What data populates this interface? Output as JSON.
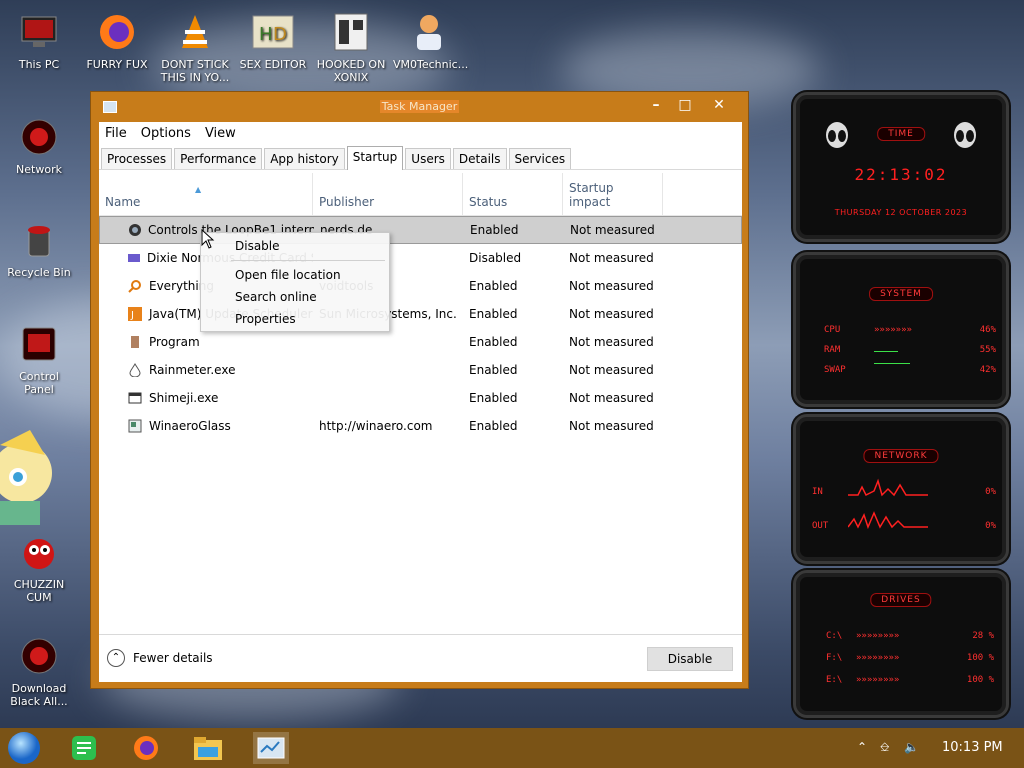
{
  "desktop": {
    "icons": [
      {
        "label": "This PC"
      },
      {
        "label": "FURRY FUX"
      },
      {
        "label": "DONT STICK THIS IN YO..."
      },
      {
        "label": "SEX EDITOR"
      },
      {
        "label": "HOOKED ON XONIX"
      },
      {
        "label": "VM0Technic..."
      },
      {
        "label": "Network"
      },
      {
        "label": "Recycle Bin"
      },
      {
        "label": "Control Panel"
      },
      {
        "label": "CHUZZIN CUM"
      },
      {
        "label": "Download Black All..."
      }
    ]
  },
  "task_manager": {
    "title": "Task Manager",
    "menu": [
      "File",
      "Options",
      "View"
    ],
    "tabs": [
      "Processes",
      "Performance",
      "App history",
      "Startup",
      "Users",
      "Details",
      "Services"
    ],
    "active_tab": "Startup",
    "columns": [
      "Name",
      "Publisher",
      "Status",
      "Startup impact"
    ],
    "rows": [
      {
        "name": "Controls the LoopBe1 intern...",
        "publisher": "nerds.de",
        "status": "Enabled",
        "impact": "Not measured",
        "icon": "loopbe-icon"
      },
      {
        "name": "Dixie Normous Credit Card S...",
        "publisher": "",
        "status": "Disabled",
        "impact": "Not measured",
        "icon": "card-icon"
      },
      {
        "name": "Everything",
        "publisher": "voidtools",
        "status": "Enabled",
        "impact": "Not measured",
        "icon": "search-icon"
      },
      {
        "name": "Java(TM) Update Scheduler",
        "publisher": "Sun Microsystems, Inc.",
        "status": "Enabled",
        "impact": "Not measured",
        "icon": "java-icon"
      },
      {
        "name": "Program",
        "publisher": "",
        "status": "Enabled",
        "impact": "Not measured",
        "icon": "program-icon"
      },
      {
        "name": "Rainmeter.exe",
        "publisher": "",
        "status": "Enabled",
        "impact": "Not measured",
        "icon": "drop-icon"
      },
      {
        "name": "Shimeji.exe",
        "publisher": "",
        "status": "Enabled",
        "impact": "Not measured",
        "icon": "window-icon"
      },
      {
        "name": "WinaeroGlass",
        "publisher": "http://winaero.com",
        "status": "Enabled",
        "impact": "Not measured",
        "icon": "glass-icon"
      }
    ],
    "context_menu": [
      "Disable",
      "Open file location",
      "Search online",
      "Properties"
    ],
    "fewer_details": "Fewer details",
    "disable_button": "Disable"
  },
  "widgets": {
    "time": {
      "title": "TIME",
      "clock": "22:13:02",
      "date": "THURSDAY 12 OCTOBER 2023"
    },
    "system": {
      "title": "SYSTEM",
      "rows": [
        {
          "label": "CPU",
          "value": "46%"
        },
        {
          "label": "RAM",
          "value": "55%"
        },
        {
          "label": "SWAP",
          "value": "42%"
        }
      ]
    },
    "network": {
      "title": "NETWORK",
      "rows": [
        {
          "label": "IN",
          "value": "0%"
        },
        {
          "label": "OUT",
          "value": "0%"
        }
      ]
    },
    "drives": {
      "title": "DRIVES",
      "rows": [
        {
          "label": "C:\\",
          "value": "28 %"
        },
        {
          "label": "F:\\",
          "value": "100 %"
        },
        {
          "label": "E:\\",
          "value": "100 %"
        }
      ]
    }
  },
  "taskbar": {
    "clock": "10:13 PM"
  }
}
